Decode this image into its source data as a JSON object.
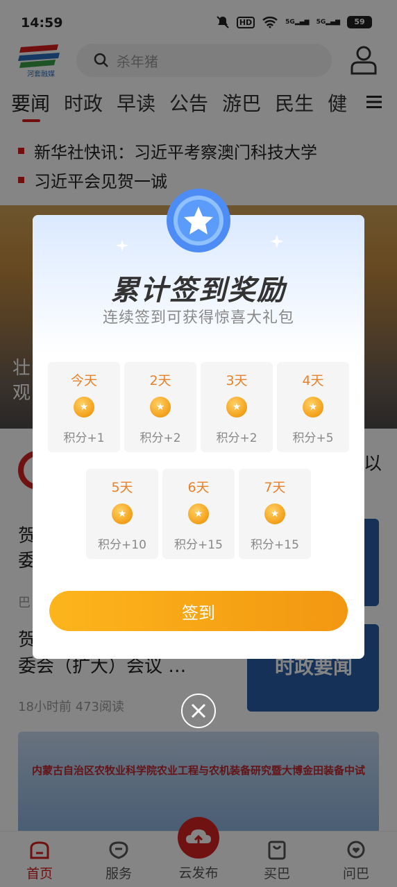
{
  "status_bar": {
    "time": "14:59",
    "battery": "59",
    "signal1": "5G",
    "signal2": "5G",
    "hd": "HD"
  },
  "header": {
    "logo_text": "河套融媒",
    "search_placeholder": "杀年猪"
  },
  "tabs": [
    "要闻",
    "时政",
    "早读",
    "公告",
    "游巴",
    "民生",
    "健"
  ],
  "headlines": [
    "新华社快讯：习近平考察澳门科技大学",
    "习近平会见贺一诚"
  ],
  "background": {
    "banner_line1": "壮",
    "banner_line2": "观",
    "item1_partial": "以",
    "item2_title_a": "贺",
    "item2_title_b": "委",
    "item2_meta": "巴",
    "item3_title_a": "贺",
    "item3_title_b": "委会（扩大）会议 …",
    "item3_meta": "18小时前   473阅读",
    "thumb_text": "时政要闻",
    "wide_banner_text": "内蒙古自治区农牧业科学院农业工程与农机装备研究暨大博金田装备中试基地成果发布会"
  },
  "modal": {
    "title": "累计签到奖励",
    "subtitle": "连续签到可获得惊喜大礼包",
    "days": [
      {
        "label": "今天",
        "points": "积分+1"
      },
      {
        "label": "2天",
        "points": "积分+2"
      },
      {
        "label": "3天",
        "points": "积分+2"
      },
      {
        "label": "4天",
        "points": "积分+5"
      },
      {
        "label": "5天",
        "points": "积分+10"
      },
      {
        "label": "6天",
        "points": "积分+15"
      },
      {
        "label": "7天",
        "points": "积分+15"
      }
    ],
    "button": "签到"
  },
  "bottom_nav": [
    "首页",
    "服务",
    "云发布",
    "买巴",
    "问巴"
  ],
  "colors": {
    "accent": "#d81e1e",
    "button_start": "#fdb51c",
    "button_end": "#f29711",
    "day_label": "#e8802a"
  }
}
